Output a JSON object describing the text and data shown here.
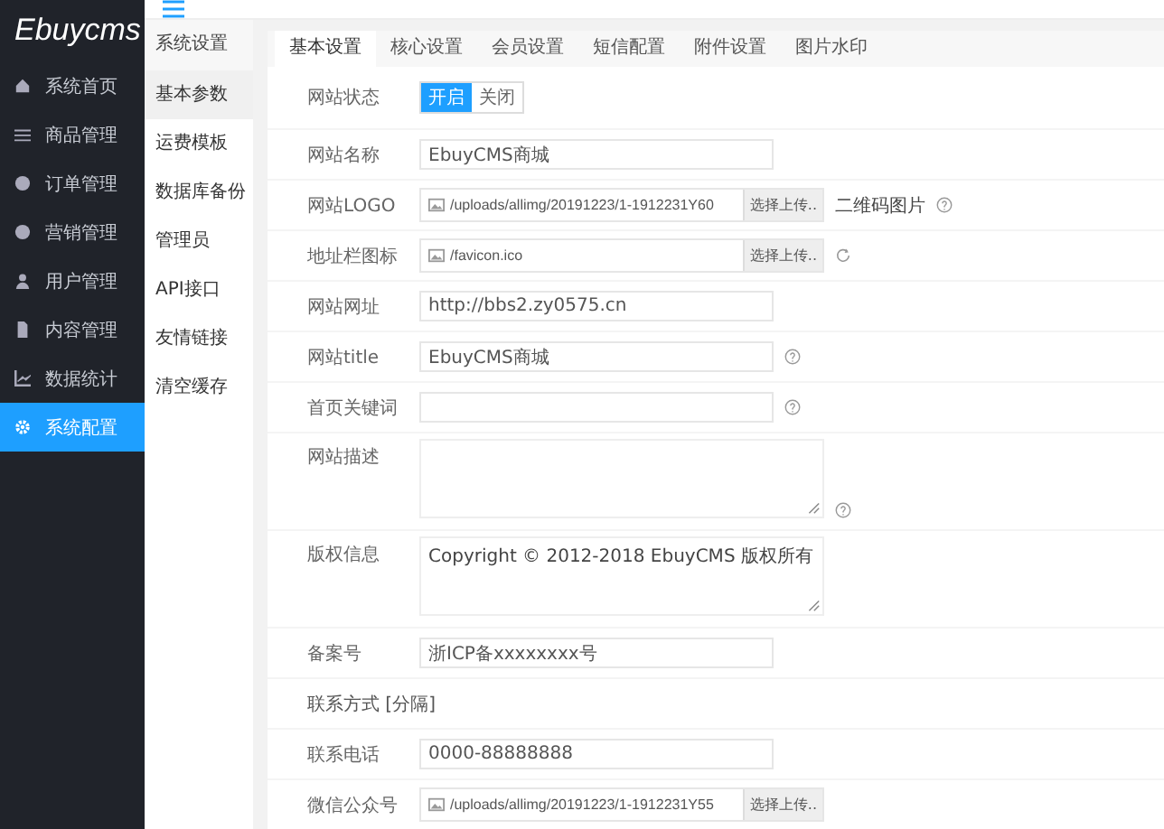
{
  "logo": "Ebuycms",
  "nav": [
    {
      "label": "系统首页",
      "selected": false
    },
    {
      "label": "商品管理",
      "selected": false
    },
    {
      "label": "订单管理",
      "selected": false
    },
    {
      "label": "营销管理",
      "selected": false
    },
    {
      "label": "用户管理",
      "selected": false
    },
    {
      "label": "内容管理",
      "selected": false
    },
    {
      "label": "数据统计",
      "selected": false
    },
    {
      "label": "系统配置",
      "selected": true
    }
  ],
  "submenu": {
    "title": "系统设置",
    "items": [
      {
        "label": "基本参数",
        "selected": true
      },
      {
        "label": "运费模板",
        "selected": false
      },
      {
        "label": "数据库备份",
        "selected": false
      },
      {
        "label": "管理员",
        "selected": false
      },
      {
        "label": "API接口",
        "selected": false
      },
      {
        "label": "友情链接",
        "selected": false
      },
      {
        "label": "清空缓存",
        "selected": false
      }
    ]
  },
  "tabs": [
    {
      "label": "基本设置",
      "selected": true
    },
    {
      "label": "核心设置",
      "selected": false
    },
    {
      "label": "会员设置",
      "selected": false
    },
    {
      "label": "短信配置",
      "selected": false
    },
    {
      "label": "附件设置",
      "selected": false
    },
    {
      "label": "图片水印",
      "selected": false
    }
  ],
  "form": [
    {
      "kind": "toggle",
      "label": "网站状态",
      "options": [
        {
          "label": "开启",
          "selected": true
        },
        {
          "label": "关闭",
          "selected": false
        }
      ]
    },
    {
      "kind": "text",
      "label": "网站名称",
      "value": "EbuyCMS商城"
    },
    {
      "kind": "file",
      "label": "网站LOGO",
      "value": "/uploads/allimg/20191223/1-1912231Y60",
      "button": "选择上传..",
      "note": "二维码图片",
      "help": true
    },
    {
      "kind": "file",
      "label": "地址栏图标",
      "value": "/favicon.ico",
      "button": "选择上传..",
      "refresh": true
    },
    {
      "kind": "text",
      "label": "网站网址",
      "value": "http://bbs2.zy0575.cn"
    },
    {
      "kind": "text",
      "label": "网站title",
      "value": "EbuyCMS商城",
      "help": true
    },
    {
      "kind": "text",
      "label": "首页关键词",
      "help": true
    },
    {
      "kind": "textarea",
      "label": "网站描述",
      "help": true
    },
    {
      "kind": "textarea",
      "label": "版权信息",
      "value": "Copyright © 2012-2018 EbuyCMS 版权所有"
    },
    {
      "kind": "text",
      "label": "备案号",
      "value": "浙ICP备xxxxxxxx号"
    },
    {
      "kind": "section",
      "label": "联系方式 [分隔]"
    },
    {
      "kind": "text",
      "label": "联系电话",
      "value": "0000-88888888"
    },
    {
      "kind": "file",
      "label": "微信公众号",
      "value": "/uploads/allimg/20191223/1-1912231Y55",
      "button": "选择上传.."
    }
  ]
}
